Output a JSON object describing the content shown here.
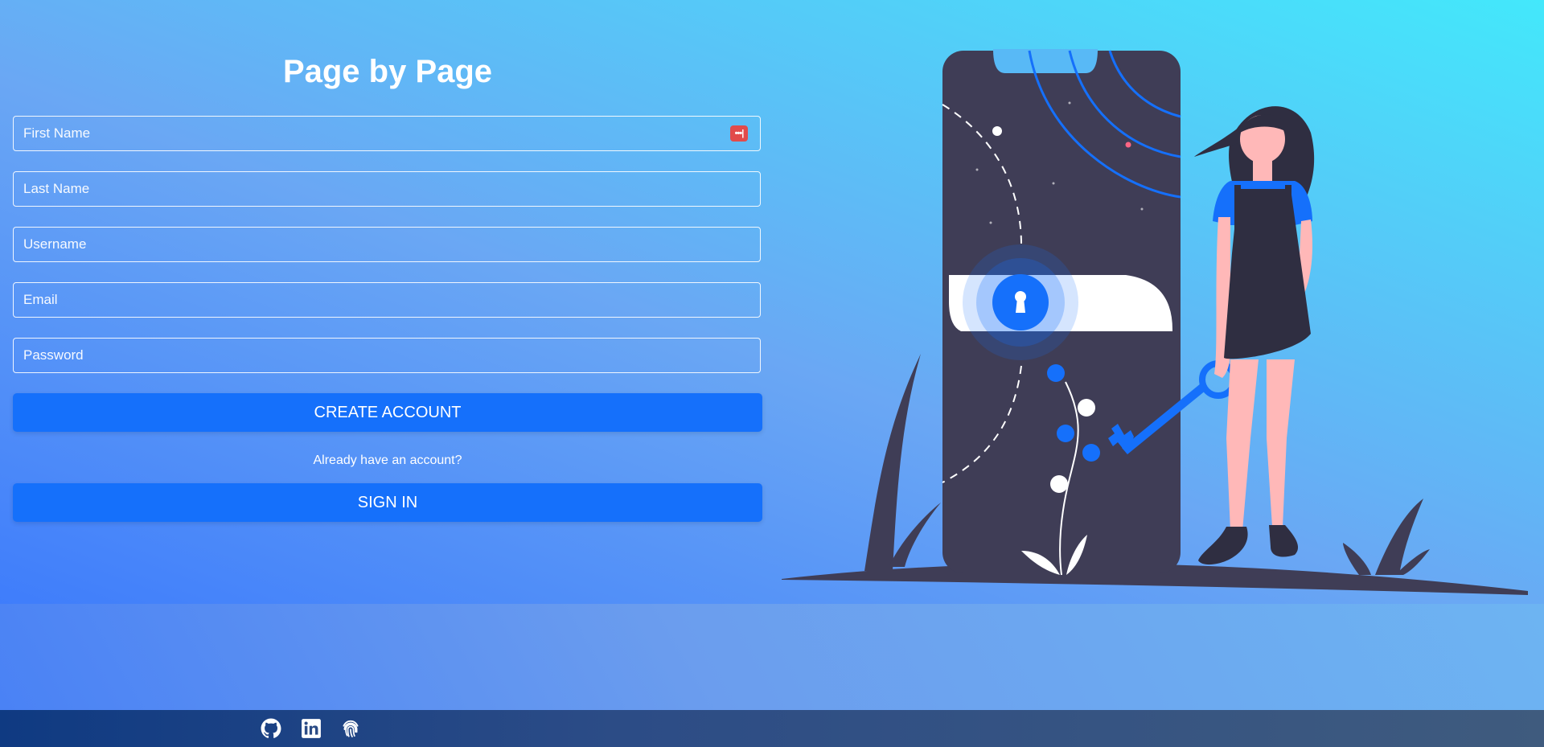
{
  "app": {
    "title": "Page by Page"
  },
  "form": {
    "first_name_placeholder": "First Name",
    "last_name_placeholder": "Last Name",
    "username_placeholder": "Username",
    "email_placeholder": "Email",
    "password_placeholder": "Password",
    "password_manager_icon": "password-manager-icon",
    "create_account_label": "CREATE ACCOUNT",
    "signin_hint": "Already have an account?",
    "sign_in_label": "SIGN IN"
  },
  "footer": {
    "links": [
      {
        "icon": "github-icon"
      },
      {
        "icon": "linkedin-icon"
      },
      {
        "icon": "fingerprint-icon"
      }
    ]
  },
  "colors": {
    "accent": "#1570fb",
    "title": "#ffffff",
    "footer": "#2c4c86",
    "illustration_dark": "#3f3d56",
    "illustration_skin": "#ffb8b8"
  }
}
